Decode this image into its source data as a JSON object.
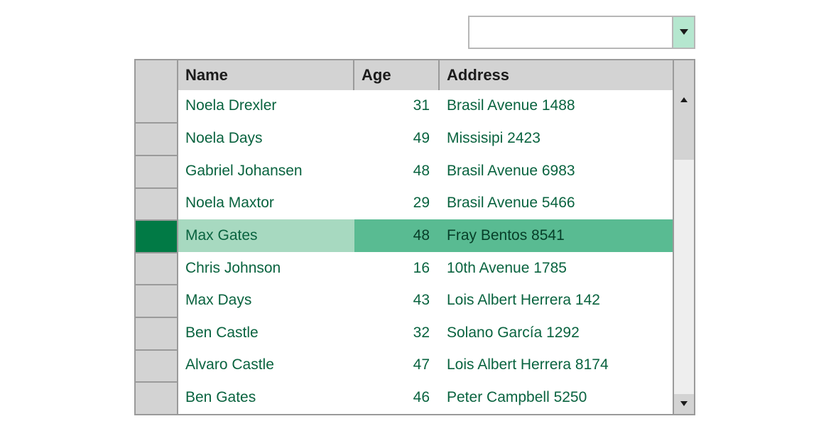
{
  "combo": {
    "value": "",
    "placeholder": ""
  },
  "grid": {
    "columns": {
      "name": "Name",
      "age": "Age",
      "address": "Address"
    },
    "selected_index": 4,
    "rows": [
      {
        "name": "Noela Drexler",
        "age": 31,
        "address": "Brasil Avenue 1488"
      },
      {
        "name": "Noela Days",
        "age": 49,
        "address": "Missisipi 2423"
      },
      {
        "name": "Gabriel Johansen",
        "age": 48,
        "address": "Brasil Avenue 6983"
      },
      {
        "name": "Noela Maxtor",
        "age": 29,
        "address": "Brasil Avenue 5466"
      },
      {
        "name": "Max Gates",
        "age": 48,
        "address": "Fray Bentos 8541"
      },
      {
        "name": "Chris Johnson",
        "age": 16,
        "address": "10th Avenue 1785"
      },
      {
        "name": "Max Days",
        "age": 43,
        "address": "Lois Albert Herrera 142"
      },
      {
        "name": "Ben Castle",
        "age": 32,
        "address": "Solano García 1292"
      },
      {
        "name": "Alvaro Castle",
        "age": 47,
        "address": "Lois Albert Herrera 8174"
      },
      {
        "name": "Ben Gates",
        "age": 46,
        "address": "Peter Campbell 5250"
      }
    ]
  }
}
